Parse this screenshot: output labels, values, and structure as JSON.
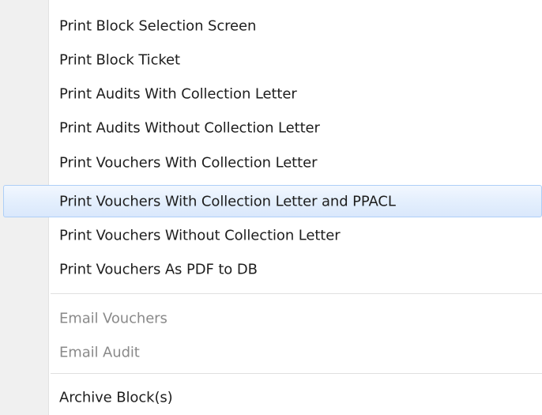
{
  "context_menu": {
    "print_items": [
      {
        "label": "Print Block Selection Screen",
        "enabled": true,
        "highlighted": false
      },
      {
        "label": "Print Block Ticket",
        "enabled": true,
        "highlighted": false
      },
      {
        "label": "Print Audits With Collection Letter",
        "enabled": true,
        "highlighted": false
      },
      {
        "label": "Print Audits Without Collection Letter",
        "enabled": true,
        "highlighted": false
      },
      {
        "label": "Print Vouchers With Collection Letter",
        "enabled": true,
        "highlighted": false
      },
      {
        "label": "Print Vouchers With Collection Letter and PPACL",
        "enabled": true,
        "highlighted": true
      },
      {
        "label": "Print Vouchers Without Collection Letter",
        "enabled": true,
        "highlighted": false
      },
      {
        "label": "Print Vouchers As PDF to DB",
        "enabled": true,
        "highlighted": false
      }
    ],
    "email_items": [
      {
        "label": "Email Vouchers",
        "enabled": false
      },
      {
        "label": "Email Audit",
        "enabled": false
      }
    ],
    "archive_items": [
      {
        "label": "Archive Block(s)",
        "enabled": true
      }
    ]
  },
  "colors": {
    "gutter": "#f0f0f0",
    "text": "#1e1e1e",
    "disabled_text": "#8a8a8a",
    "highlight_border": "#aecff7",
    "highlight_fill": "#e4effd"
  }
}
